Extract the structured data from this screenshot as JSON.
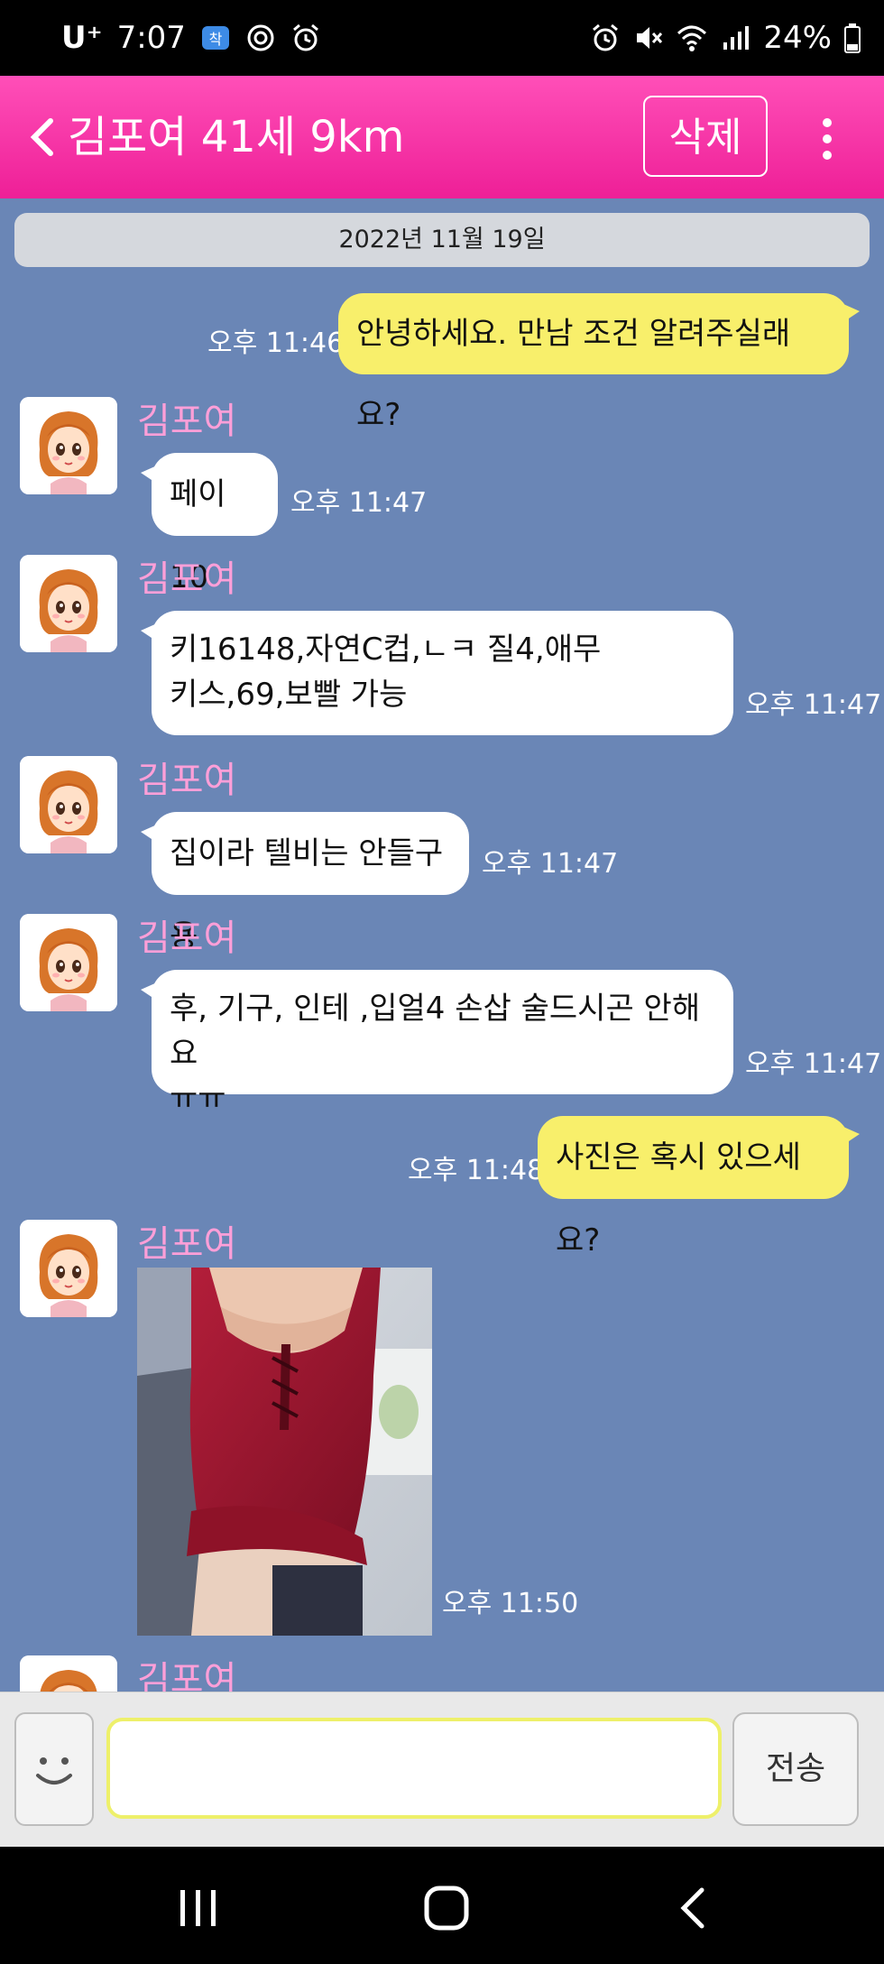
{
  "status_bar": {
    "carrier": "U⁺",
    "time": "7:07",
    "battery": "24%"
  },
  "header": {
    "title": "김포여 41세 9km",
    "delete_label": "삭제"
  },
  "chat": {
    "date": "2022년 11월 19일",
    "messages": [
      {
        "side": "right",
        "text": "안녕하세요. 만남 조건 알려주실래요?",
        "time": "오후 11:46"
      },
      {
        "side": "left",
        "sender": "김포여",
        "text": "페이10",
        "time": "오후 11:47"
      },
      {
        "side": "left",
        "sender": "김포여",
        "text": "키16148,자연C컵,ㄴㅋ 질4,애무\n키스,69,보빨 가능",
        "time": "오후 11:47"
      },
      {
        "side": "left",
        "sender": "김포여",
        "text": "집이라 텔비는 안들구용",
        "time": "오후 11:47"
      },
      {
        "side": "left",
        "sender": "김포여",
        "text": "후, 기구, 인테 ,입얼4 손삽 술드시곤 안해요\nㅠㅠ",
        "time": "오후 11:47"
      },
      {
        "side": "right",
        "text": "사진은 혹시 있으세요?",
        "time": "오후 11:48"
      },
      {
        "side": "left",
        "sender": "김포여",
        "type": "photo",
        "time": "오후 11:50"
      },
      {
        "side": "left",
        "sender": "김포여"
      }
    ]
  },
  "composer": {
    "send_label": "전송",
    "input_value": ""
  },
  "icons": {
    "back": "chevron-left-icon",
    "more": "more-vertical-icon",
    "emoji": "smiley-icon",
    "nav_recents": "recents-icon",
    "nav_home": "home-icon",
    "nav_back": "back-icon"
  },
  "colors": {
    "header": "#f22fa6",
    "chat_bg": "#6a86b6",
    "my_bubble": "#f8ef6b",
    "their_bubble": "#ffffff",
    "sender_name": "#ff9fd8"
  }
}
